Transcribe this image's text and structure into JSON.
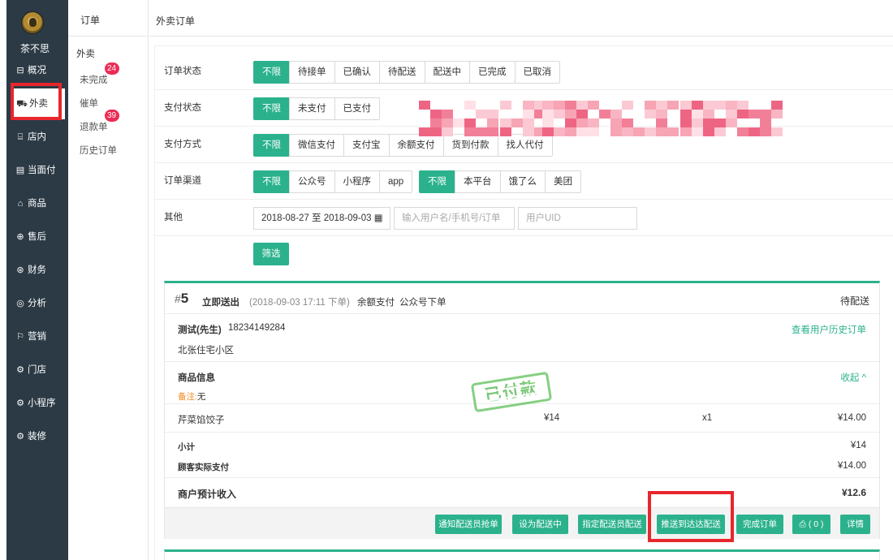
{
  "app": {
    "brand": "茶不思"
  },
  "sidebar": {
    "items": [
      {
        "label": "概况",
        "icon": "overview-icon",
        "glyph": "⊟"
      },
      {
        "label": "外卖",
        "icon": "takeout-icon",
        "glyph": "⛟"
      },
      {
        "label": "店内",
        "icon": "dine-in-icon",
        "glyph": "⌸"
      },
      {
        "label": "当面付",
        "icon": "face-pay-icon",
        "glyph": "▤"
      },
      {
        "label": "商品",
        "icon": "goods-icon",
        "glyph": "⌂"
      },
      {
        "label": "售后",
        "icon": "after-sales-icon",
        "glyph": "⊕"
      },
      {
        "label": "财务",
        "icon": "finance-icon",
        "glyph": "⊛"
      },
      {
        "label": "分析",
        "icon": "analysis-icon",
        "glyph": "◎"
      },
      {
        "label": "营销",
        "icon": "marketing-icon",
        "glyph": "⚐"
      },
      {
        "label": "门店",
        "icon": "store-icon",
        "glyph": "⚙"
      },
      {
        "label": "小程序",
        "icon": "mini-program-icon",
        "glyph": "⚙"
      },
      {
        "label": "装修",
        "icon": "decoration-icon",
        "glyph": "⚙"
      }
    ]
  },
  "subnav": {
    "title": "订单",
    "group": "外卖",
    "items": [
      {
        "label": "未完成",
        "badge": "24"
      },
      {
        "label": "催单",
        "badge": ""
      },
      {
        "label": "退款单",
        "badge": "39"
      },
      {
        "label": "历史订单",
        "badge": ""
      }
    ]
  },
  "main": {
    "title": "外卖订单"
  },
  "filters": {
    "order_status": {
      "label": "订单状态",
      "options": [
        "不限",
        "待接单",
        "已确认",
        "待配送",
        "配送中",
        "已完成",
        "已取消"
      ]
    },
    "pay_status": {
      "label": "支付状态",
      "options": [
        "不限",
        "未支付",
        "已支付"
      ]
    },
    "pay_method": {
      "label": "支付方式",
      "options": [
        "不限",
        "微信支付",
        "支付宝",
        "余额支付",
        "货到付款",
        "找人代付"
      ]
    },
    "channel": {
      "label": "订单渠道",
      "options": [
        "不限",
        "公众号",
        "小程序",
        "app"
      ],
      "platforms": [
        "不限",
        "本平台",
        "饿了么",
        "美团"
      ]
    },
    "other": {
      "label": "其他",
      "date_range": "2018-08-27 至 2018-09-03",
      "calendar_icon": "calendar-icon",
      "search_placeholder": "输入用户名/手机号/订单",
      "uid_placeholder": "用户UID"
    },
    "submit": "筛选"
  },
  "order": {
    "hash": "#",
    "number": "5",
    "type": "立即送出",
    "time": "(2018-09-03 17:11 下单)",
    "payment": "余额支付",
    "source": "公众号下单",
    "status": "待配送",
    "customer": "测试(先生)",
    "phone": "18234149284",
    "address": "北张住宅小区",
    "history_link": "查看用户历史订单",
    "goods_title": "商品信息",
    "collapse": "收起 ^",
    "note_label": "备注:",
    "note_value": "无",
    "stamp": "已付款",
    "items": [
      {
        "name": "芹菜馅饺子",
        "price": "¥14",
        "qty": "x1",
        "total": "¥14.00"
      }
    ],
    "subtotal_label": "小计",
    "subtotal": "¥14",
    "paid_label": "顾客实际支付",
    "paid": "¥14.00",
    "income_label": "商户预计收入",
    "income": "¥12.6",
    "actions": [
      "通知配送员抢单",
      "设为配送中",
      "指定配送员配送",
      "推送到达达配送",
      "完成订单",
      "⎙ ( 0 )",
      "详情"
    ]
  },
  "colors": {
    "accent": "#2bb28d",
    "sidebar": "#2b3a45",
    "badge": "#ed2c55",
    "highlight": "#e8262d"
  }
}
